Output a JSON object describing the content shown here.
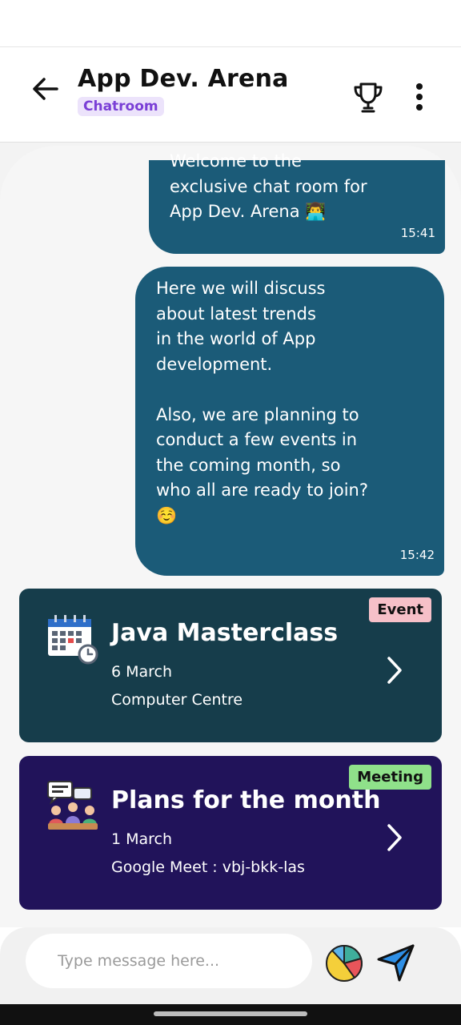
{
  "header": {
    "title": "App Dev. Arena",
    "badge": "Chatroom",
    "icons": [
      "back-arrow-icon",
      "trophy-icon",
      "more-vertical-icon"
    ]
  },
  "messages": [
    {
      "text": "Welcome to the\nexclusive chat room for\nApp Dev. Arena 👨‍💻",
      "time": "15:41"
    },
    {
      "text": "Here we will discuss\nabout latest trends\nin the world of App\ndevelopment.\n\nAlso, we are planning to\nconduct a few events in\nthe coming month, so\nwho all are ready to join?\n☺️",
      "time": "15:42"
    }
  ],
  "cards": [
    {
      "tag": "Event",
      "title": "Java Masterclass",
      "date": "6 March",
      "subtitle": "Computer Centre",
      "icon": "calendar-icon"
    },
    {
      "tag": "Meeting",
      "title": "Plans for the month",
      "date": "1 March",
      "subtitle": "Google Meet : vbj-bkk-las",
      "icon": "meeting-icon"
    }
  ],
  "composer": {
    "placeholder": "Type message here...",
    "icons": [
      "pie-chart-icon",
      "send-icon"
    ]
  },
  "colors": {
    "bubble": "#1b5b78",
    "event_card": "#163d4b",
    "meeting_card": "#21135a",
    "event_tag": "#f6c0c8",
    "meeting_tag": "#8fe18a",
    "badge_bg": "#ece3fb",
    "badge_text": "#7a3fd6"
  }
}
